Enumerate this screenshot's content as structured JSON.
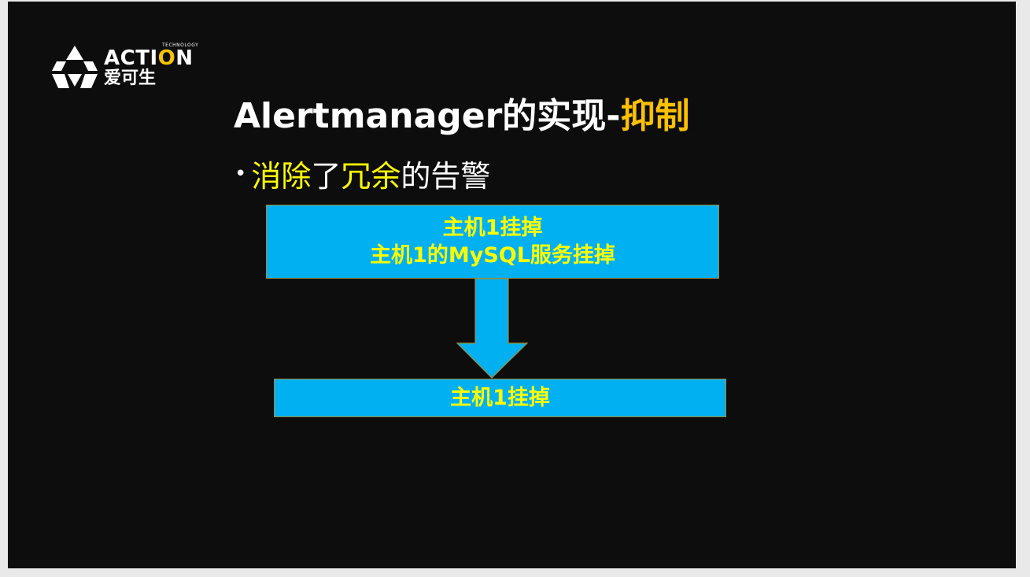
{
  "logo": {
    "brand_part1": "ACTI",
    "brand_accent": "O",
    "brand_part2": "N",
    "tagline": "TECHNOLOGY",
    "chinese_name": "爱可生",
    "accent_color": "#f5c400"
  },
  "title": {
    "main": "Alertmanager的实现-",
    "highlight": "抑制",
    "highlight_color": "#ffc000"
  },
  "bullet": {
    "dot": "•",
    "part1": "消除",
    "part2": "了",
    "part3": "冗余",
    "part4": "的告警"
  },
  "diagram": {
    "top_box_line1": "主机1挂掉",
    "top_box_line2": "主机1的MySQL服务挂掉",
    "bottom_box": "主机1挂掉",
    "box_color": "#00b0f0",
    "text_color": "#ffff00"
  }
}
